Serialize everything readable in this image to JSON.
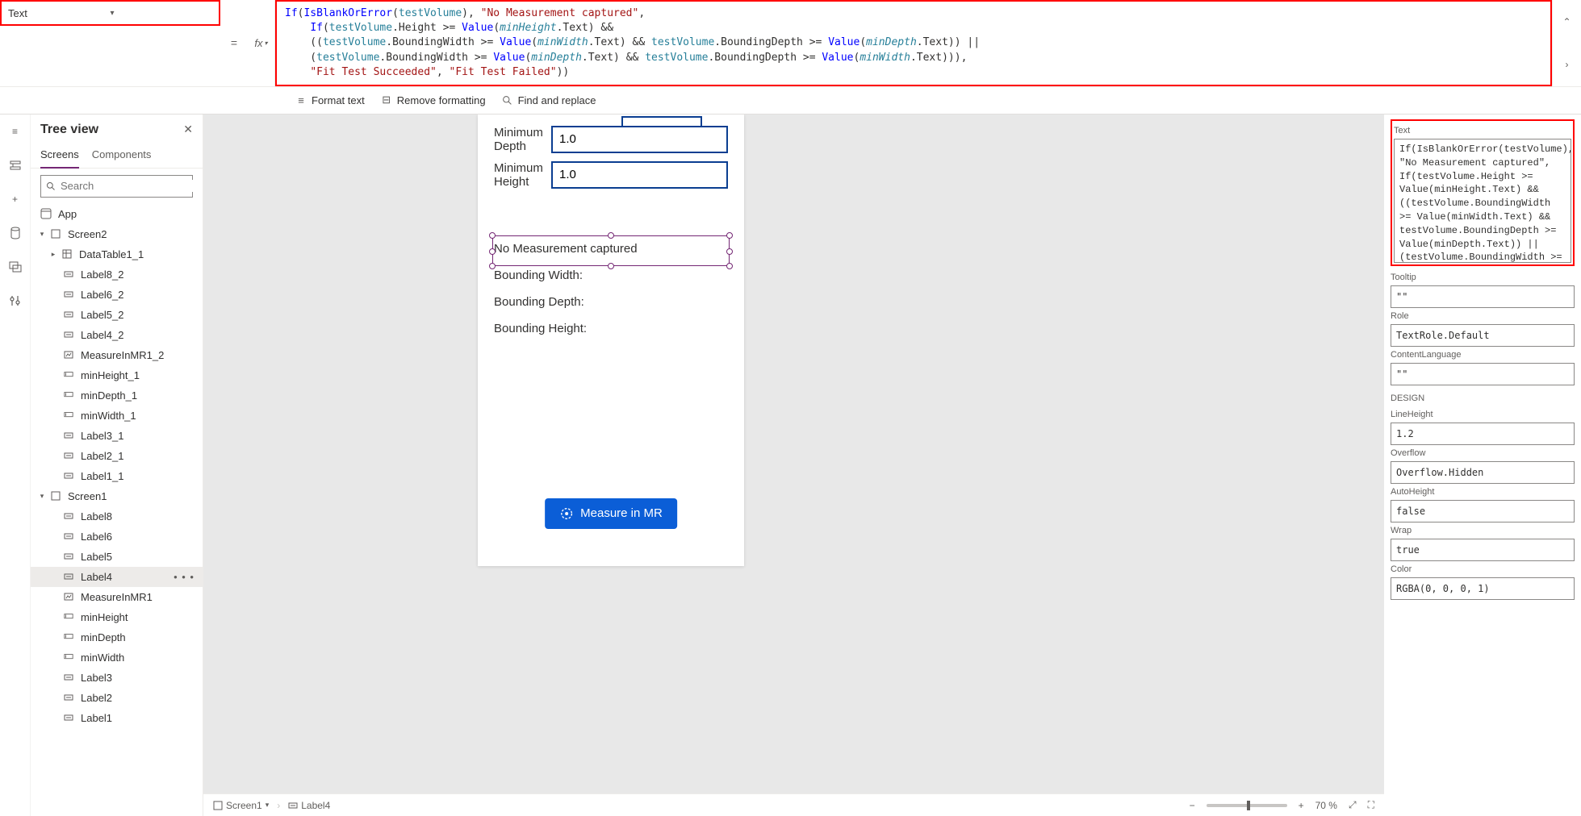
{
  "propertySelector": {
    "label": "Text"
  },
  "formula": {
    "line1": "If(IsBlankOrError(testVolume), \"No Measurement captured\",",
    "line2a": "    If(testVolume.Height >= Value(",
    "line2b": "minHeight",
    "line2c": ".Text) &&",
    "line3": "    ((testVolume.BoundingWidth >= Value(minWidth.Text) && testVolume.BoundingDepth >= Value(minDepth.Text)) ||",
    "line4": "    (testVolume.BoundingWidth >= Value(minDepth.Text) && testVolume.BoundingDepth >= Value(minWidth.Text))),",
    "line5": "    \"Fit Test Succeeded\", \"Fit Test Failed\"))"
  },
  "toolbar": {
    "format": "Format text",
    "remove": "Remove formatting",
    "find": "Find and replace"
  },
  "treeView": {
    "title": "Tree view",
    "tabs": {
      "screens": "Screens",
      "components": "Components"
    },
    "searchPlaceholder": "Search",
    "appLabel": "App"
  },
  "tree": [
    {
      "label": "Screen2",
      "icon": "screen",
      "level": 0,
      "expandable": true,
      "expanded": true
    },
    {
      "label": "DataTable1_1",
      "icon": "table",
      "level": 1,
      "expandable": true,
      "expanded": false
    },
    {
      "label": "Label8_2",
      "icon": "label",
      "level": 1
    },
    {
      "label": "Label6_2",
      "icon": "label",
      "level": 1
    },
    {
      "label": "Label5_2",
      "icon": "label",
      "level": 1
    },
    {
      "label": "Label4_2",
      "icon": "label",
      "level": 1
    },
    {
      "label": "MeasureInMR1_2",
      "icon": "mr",
      "level": 1
    },
    {
      "label": "minHeight_1",
      "icon": "input",
      "level": 1
    },
    {
      "label": "minDepth_1",
      "icon": "input",
      "level": 1
    },
    {
      "label": "minWidth_1",
      "icon": "input",
      "level": 1
    },
    {
      "label": "Label3_1",
      "icon": "label",
      "level": 1
    },
    {
      "label": "Label2_1",
      "icon": "label",
      "level": 1
    },
    {
      "label": "Label1_1",
      "icon": "label",
      "level": 1
    },
    {
      "label": "Screen1",
      "icon": "screen",
      "level": 0,
      "expandable": true,
      "expanded": true
    },
    {
      "label": "Label8",
      "icon": "label",
      "level": 1
    },
    {
      "label": "Label6",
      "icon": "label",
      "level": 1
    },
    {
      "label": "Label5",
      "icon": "label",
      "level": 1
    },
    {
      "label": "Label4",
      "icon": "label",
      "level": 1,
      "selected": true
    },
    {
      "label": "MeasureInMR1",
      "icon": "mr",
      "level": 1
    },
    {
      "label": "minHeight",
      "icon": "input",
      "level": 1
    },
    {
      "label": "minDepth",
      "icon": "input",
      "level": 1
    },
    {
      "label": "minWidth",
      "icon": "input",
      "level": 1
    },
    {
      "label": "Label3",
      "icon": "label",
      "level": 1
    },
    {
      "label": "Label2",
      "icon": "label",
      "level": 1
    },
    {
      "label": "Label1",
      "icon": "label",
      "level": 1
    }
  ],
  "canvas": {
    "minDepthLabel": "Minimum Depth",
    "minDepthValue": "1.0",
    "minHeightLabel": "Minimum Height",
    "minHeightValue": "1.0",
    "selectedText": "No Measurement captured",
    "bWidth": "Bounding Width:",
    "bDepth": "Bounding Depth:",
    "bHeight": "Bounding Height:",
    "mrButton": "Measure in MR"
  },
  "status": {
    "crumb1": "Screen1",
    "crumb2": "Label4",
    "zoom": "70 %"
  },
  "props": {
    "textLabel": "Text",
    "textValue": "If(IsBlankOrError(testVolume), \"No Measurement captured\",\nIf(testVolume.Height >= Value(minHeight.Text) &&\n((testVolume.BoundingWidth >= Value(minWidth.Text) && testVolume.BoundingDepth >= Value(minDepth.Text)) ||\n(testVolume.BoundingWidth >= Value(minDepth.Text) &&",
    "tooltipLabel": "Tooltip",
    "tooltipValue": "\"\"",
    "roleLabel": "Role",
    "roleValue": "TextRole.Default",
    "langLabel": "ContentLanguage",
    "langValue": "\"\"",
    "designHeader": "DESIGN",
    "lineHeightLabel": "LineHeight",
    "lineHeightValue": "1.2",
    "overflowLabel": "Overflow",
    "overflowValue": "Overflow.Hidden",
    "autoHeightLabel": "AutoHeight",
    "autoHeightValue": "false",
    "wrapLabel": "Wrap",
    "wrapValue": "true",
    "colorLabel": "Color",
    "colorValue": "RGBA(0, 0, 0, 1)"
  }
}
